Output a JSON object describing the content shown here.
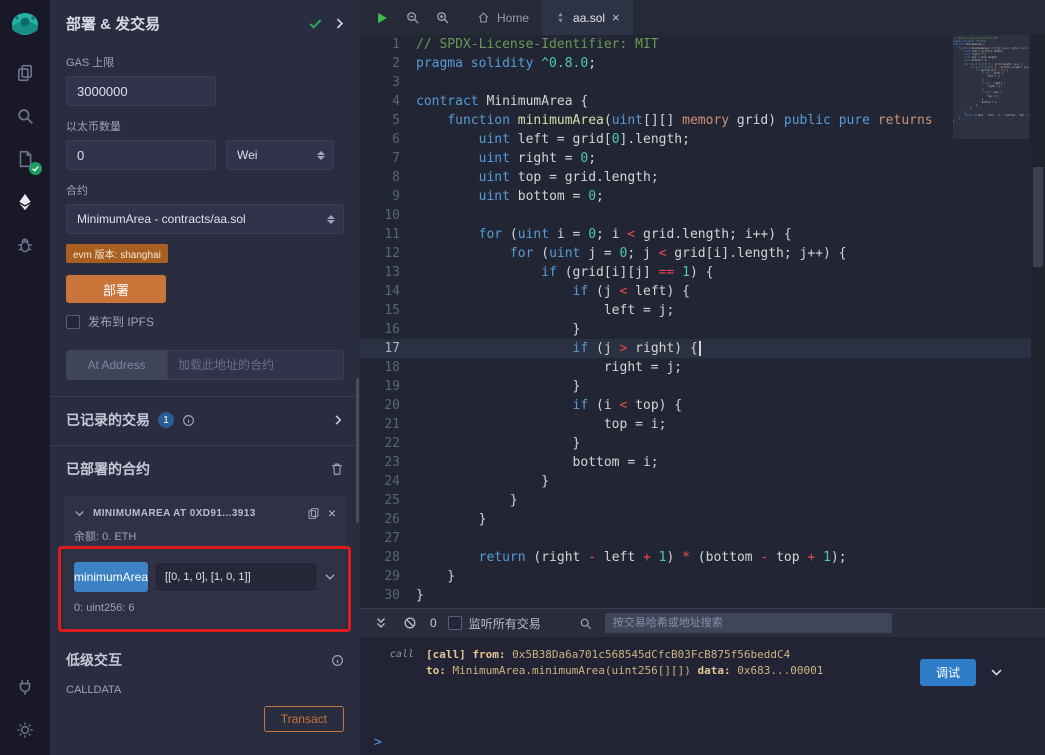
{
  "colors": {
    "accent_blue": "#3c82c4",
    "deploy_orange": "#c97539",
    "annotation_red": "#e01b1b",
    "success_green": "#1d9d5f"
  },
  "icons": {
    "iconbar": [
      "remix-logo",
      "file-explorer-icon",
      "search-icon",
      "solidity-compiler-icon",
      "deploy-run-icon",
      "debugger-icon",
      "plugin-manager-icon",
      "settings-gear-icon"
    ],
    "misc": [
      "check-icon",
      "chevron-right-icon",
      "chevron-down-icon",
      "info-icon",
      "trash-icon",
      "copy-icon",
      "close-icon",
      "play-icon",
      "zoom-out-icon",
      "zoom-in-icon",
      "home-icon",
      "solidity-icon",
      "double-chevron-down-icon",
      "ban-icon",
      "search-icon"
    ]
  },
  "side_panel": {
    "title": "部署 & 发交易",
    "gas": {
      "label": "GAS 上限",
      "value": "3000000"
    },
    "value": {
      "label": "以太币数量",
      "amount": "0",
      "unit": "Wei"
    },
    "contract": {
      "label": "合约",
      "selected": "MinimumArea - contracts/aa.sol"
    },
    "evm_badge": "evm 版本: shanghai",
    "deploy_button": "部署",
    "publish_ipfs_label": "发布到 IPFS",
    "at_address": {
      "button": "At Address",
      "placeholder": "加载此地址的合约"
    },
    "recorded_transactions": {
      "title": "已记录的交易",
      "count": "1"
    },
    "deployed_contracts": {
      "title": "已部署的合约"
    },
    "instance": {
      "header": "MINIMUMAREA AT 0XD91...3913",
      "balance": "余额: 0. ETH",
      "method_button": "minimumArea",
      "method_args": "[[0, 1, 0], [1, 0, 1]]",
      "result": "0: uint256: 6"
    },
    "low_level": {
      "title": "低级交互",
      "calldata_label": "CALLDATA",
      "transact_button": "Transact"
    }
  },
  "editor": {
    "tabs": [
      {
        "label": "Home"
      },
      {
        "label": "aa.sol"
      }
    ],
    "active_line": 17,
    "lines": [
      [
        [
          "cm",
          "// SPDX-License-Identifier: MIT"
        ]
      ],
      [
        [
          "kw",
          "pragma solidity"
        ],
        [
          "pl",
          " "
        ],
        [
          "num",
          "^0.8.0"
        ],
        [
          "pl",
          ";"
        ]
      ],
      [],
      [
        [
          "kw",
          "contract"
        ],
        [
          "pl",
          " MinimumArea {"
        ]
      ],
      [
        [
          "pl",
          "    "
        ],
        [
          "kw",
          "function"
        ],
        [
          "pl",
          " "
        ],
        [
          "fn",
          "minimumArea"
        ],
        [
          "pl",
          "("
        ],
        [
          "kw",
          "uint"
        ],
        [
          "pl",
          "[][] "
        ],
        [
          "st",
          "memory"
        ],
        [
          "pl",
          " grid) "
        ],
        [
          "kw",
          "public"
        ],
        [
          "pl",
          " "
        ],
        [
          "kw",
          "pure"
        ],
        [
          "pl",
          " "
        ],
        [
          "st",
          "returns"
        ]
      ],
      [
        [
          "pl",
          "        "
        ],
        [
          "kw",
          "uint"
        ],
        [
          "pl",
          " left = grid["
        ],
        [
          "num",
          "0"
        ],
        [
          "pl",
          "].length;"
        ]
      ],
      [
        [
          "pl",
          "        "
        ],
        [
          "kw",
          "uint"
        ],
        [
          "pl",
          " right = "
        ],
        [
          "num",
          "0"
        ],
        [
          "pl",
          ";"
        ]
      ],
      [
        [
          "pl",
          "        "
        ],
        [
          "kw",
          "uint"
        ],
        [
          "pl",
          " top = grid.length;"
        ]
      ],
      [
        [
          "pl",
          "        "
        ],
        [
          "kw",
          "uint"
        ],
        [
          "pl",
          " bottom = "
        ],
        [
          "num",
          "0"
        ],
        [
          "pl",
          ";"
        ]
      ],
      [],
      [
        [
          "pl",
          "        "
        ],
        [
          "kw",
          "for"
        ],
        [
          "pl",
          " ("
        ],
        [
          "kw",
          "uint"
        ],
        [
          "pl",
          " i = "
        ],
        [
          "num",
          "0"
        ],
        [
          "pl",
          "; i "
        ],
        [
          "op",
          "<"
        ],
        [
          "pl",
          " grid.length; i++) {"
        ]
      ],
      [
        [
          "pl",
          "            "
        ],
        [
          "kw",
          "for"
        ],
        [
          "pl",
          " ("
        ],
        [
          "kw",
          "uint"
        ],
        [
          "pl",
          " j = "
        ],
        [
          "num",
          "0"
        ],
        [
          "pl",
          "; j "
        ],
        [
          "op",
          "<"
        ],
        [
          "pl",
          " grid[i].length; j++) {"
        ]
      ],
      [
        [
          "pl",
          "                "
        ],
        [
          "kw",
          "if"
        ],
        [
          "pl",
          " (grid[i][j] "
        ],
        [
          "op",
          "=="
        ],
        [
          "pl",
          " "
        ],
        [
          "num",
          "1"
        ],
        [
          "pl",
          ") {"
        ]
      ],
      [
        [
          "pl",
          "                    "
        ],
        [
          "kw",
          "if"
        ],
        [
          "pl",
          " (j "
        ],
        [
          "op",
          "<"
        ],
        [
          "pl",
          " left) {"
        ]
      ],
      [
        [
          "pl",
          "                        left = j;"
        ]
      ],
      [
        [
          "pl",
          "                    }"
        ]
      ],
      [
        [
          "pl",
          "                    "
        ],
        [
          "kw",
          "if"
        ],
        [
          "pl",
          " (j "
        ],
        [
          "op",
          ">"
        ],
        [
          "pl",
          " right) {"
        ]
      ],
      [
        [
          "pl",
          "                        right = j;"
        ]
      ],
      [
        [
          "pl",
          "                    }"
        ]
      ],
      [
        [
          "pl",
          "                    "
        ],
        [
          "kw",
          "if"
        ],
        [
          "pl",
          " (i "
        ],
        [
          "op",
          "<"
        ],
        [
          "pl",
          " top) {"
        ]
      ],
      [
        [
          "pl",
          "                        top = i;"
        ]
      ],
      [
        [
          "pl",
          "                    }"
        ]
      ],
      [
        [
          "pl",
          "                    bottom = i;"
        ]
      ],
      [
        [
          "pl",
          "                }"
        ]
      ],
      [
        [
          "pl",
          "            }"
        ]
      ],
      [
        [
          "pl",
          "        }"
        ]
      ],
      [],
      [
        [
          "pl",
          "        "
        ],
        [
          "kw",
          "return"
        ],
        [
          "pl",
          " (right "
        ],
        [
          "op",
          "-"
        ],
        [
          "pl",
          " left "
        ],
        [
          "op",
          "+"
        ],
        [
          "pl",
          " "
        ],
        [
          "num",
          "1"
        ],
        [
          "pl",
          ") "
        ],
        [
          "op",
          "*"
        ],
        [
          "pl",
          " (bottom "
        ],
        [
          "op",
          "-"
        ],
        [
          "pl",
          " top "
        ],
        [
          "op",
          "+"
        ],
        [
          "pl",
          " "
        ],
        [
          "num",
          "1"
        ],
        [
          "pl",
          ");"
        ]
      ],
      [
        [
          "pl",
          "    }"
        ]
      ],
      [
        [
          "pl",
          "}"
        ]
      ]
    ]
  },
  "terminal": {
    "tx_count": "0",
    "listen_label": "监听所有交易",
    "search_placeholder": "按交易哈希或地址搜索",
    "log": {
      "gutter": "call",
      "tag": "[call] ",
      "from_label": "from: ",
      "from_value": "0x5B38Da6a701c568545dCfcB03FcB875f56beddC4\n",
      "to_label": "to: ",
      "to_value": "MinimumArea.minimumArea(uint256[][]) ",
      "data_label": "data: ",
      "data_value": "0x683...00001",
      "debug_button": "调试"
    },
    "prompt": ">"
  }
}
